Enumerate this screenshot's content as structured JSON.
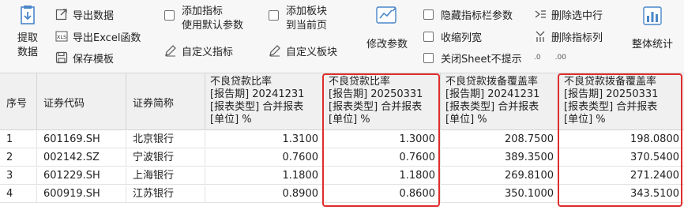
{
  "toolbar": {
    "extract": {
      "line1": "提取",
      "line2": "数据",
      "icon": "extract-data-icon"
    },
    "export_data": {
      "label": "导出数据",
      "icon": "export-icon"
    },
    "export_excel": {
      "label": "导出Excel函数",
      "icon": "xls-icon"
    },
    "save_template": {
      "label": "保存模板",
      "icon": "save-icon"
    },
    "add_indicator": {
      "line1": "添加指标",
      "line2": "使用默认参数"
    },
    "custom_indicator": {
      "label": "自定义指标",
      "icon": "edit-icon"
    },
    "add_sector": {
      "line1": "添加板块",
      "line2": "到当前页"
    },
    "custom_sector": {
      "label": "自定义板块",
      "icon": "edit-icon"
    },
    "modify_params": {
      "label": "修改参数",
      "icon": "chart-edit-icon"
    },
    "hide_indicator_params": {
      "label": "隐藏指标栏参数",
      "checked": false
    },
    "shrink_width": {
      "label": "收缩列宽",
      "checked": false
    },
    "close_sheet_tip": {
      "label": "关闭Sheet不提示",
      "checked": false
    },
    "delete_selected_rows": {
      "label": "删除选中行",
      "icon": "delete-row-icon"
    },
    "delete_indicator_col": {
      "label": "删除指标列",
      "icon": "delete-col-icon"
    },
    "decimal_icons": [
      ".0",
      ".00"
    ],
    "overall_stats": {
      "label": "整体统计",
      "icon": "stats-icon"
    }
  },
  "table": {
    "headers": {
      "seq": "序号",
      "code": "证券代码",
      "name": "证券简称",
      "c1": {
        "l1": "不良贷款比率",
        "l2": "[报告期] 20241231",
        "l3": "[报表类型] 合并报表",
        "l4": "[单位] %"
      },
      "c2": {
        "l1": "不良贷款比率",
        "l2": "[报告期] 20250331",
        "l3": "[报表类型] 合并报表",
        "l4": "[单位] %"
      },
      "c3": {
        "l1": "不良贷款拨备覆盖率",
        "l2": "[报告期] 20241231",
        "l3": "[报表类型] 合并报表",
        "l4": "[单位] %"
      },
      "c4": {
        "l1": "不良贷款拨备覆盖率",
        "l2": "[报告期] 20250331",
        "l3": "[报表类型] 合并报表",
        "l4": "[单位] %"
      }
    },
    "rows": [
      {
        "seq": "1",
        "code": "601169.SH",
        "name": "北京银行",
        "v1": "1.3100",
        "v2": "1.3000",
        "v3": "208.7500",
        "v4": "198.0800"
      },
      {
        "seq": "2",
        "code": "002142.SZ",
        "name": "宁波银行",
        "v1": "0.7600",
        "v2": "0.7600",
        "v3": "389.3500",
        "v4": "370.5400"
      },
      {
        "seq": "3",
        "code": "601229.SH",
        "name": "上海银行",
        "v1": "1.1800",
        "v2": "1.1800",
        "v3": "269.8100",
        "v4": "271.2400"
      },
      {
        "seq": "4",
        "code": "600919.SH",
        "name": "江苏银行",
        "v1": "0.8900",
        "v2": "0.8600",
        "v3": "350.1000",
        "v4": "343.5100"
      }
    ]
  },
  "colors": {
    "highlight": "#e02d2d",
    "icon_blue": "#4a86c8"
  }
}
